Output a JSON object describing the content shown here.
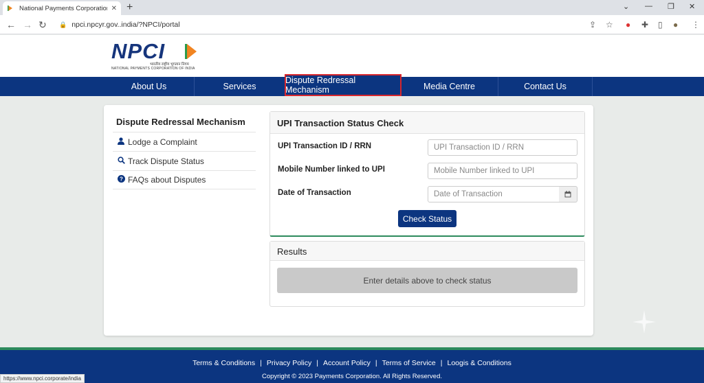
{
  "browser": {
    "tab_title": "National Payments Corporation o",
    "url": "npci.npcyr.gov..india/?NPCI/portal",
    "status_url": "https://www.npci.corporate/india"
  },
  "header": {
    "logo_text": "NPCI",
    "logo_hindi": "भारतीय राष्ट्रीय भुगतान निगम",
    "logo_org": "NATIONAL PAYMENTS CORPORATION OF INDIA"
  },
  "nav": {
    "items": [
      {
        "label": "About Us"
      },
      {
        "label": "Services"
      },
      {
        "label": "Dispute Redressal Mechanism"
      },
      {
        "label": "Media Centre"
      },
      {
        "label": "Contact Us"
      }
    ],
    "active_index": 2
  },
  "sidebar": {
    "title": "Dispute Redressal Mechanism",
    "links": [
      {
        "label": "Lodge a Complaint",
        "icon": "user-icon"
      },
      {
        "label": "Track Dispute Status",
        "icon": "search-icon"
      },
      {
        "label": "FAQs about Disputes",
        "icon": "question-icon"
      }
    ]
  },
  "form": {
    "title": "UPI Transaction Status Check",
    "fields": [
      {
        "label": "UPI Transaction ID / RRN",
        "placeholder": "UPI Transaction ID / RRN",
        "value": ""
      },
      {
        "label": "Mobile Number linked to UPI",
        "placeholder": "Mobile Number linked to UPI",
        "value": ""
      },
      {
        "label": "Date of Transaction",
        "placeholder": "Date of Transaction",
        "value": ""
      }
    ],
    "submit_label": "Check Status"
  },
  "results": {
    "title": "Results",
    "message": "Enter details above to check status"
  },
  "footer": {
    "links": [
      "Terms & Conditions",
      "Privacy Policy",
      "Account Policy",
      "Terms of Service",
      "Loogis & Conditions"
    ],
    "copyright": "Copyright © 2023 Payments Corporation. All Rights Reserved."
  },
  "colors": {
    "nav_bg": "#0c3580",
    "accent_green": "#2c8a5c",
    "active_outline": "#d8262c"
  }
}
